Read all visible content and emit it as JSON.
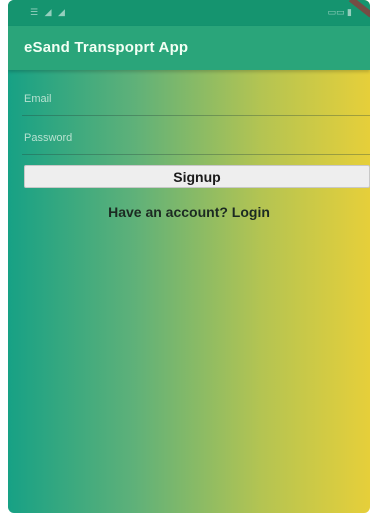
{
  "status_bar": {
    "left_icons": "☰ ◢ ◢",
    "right_icons": "▭▭ ▮"
  },
  "app_bar": {
    "title": "eSand Transpoprt App"
  },
  "form": {
    "email_placeholder": "Email",
    "password_placeholder": "Password",
    "signup_label": "Signup",
    "login_link": "Have an account? Login"
  },
  "colors": {
    "gradient_start": "#17a185",
    "gradient_end": "#e6cf3a",
    "app_bar": "#2aa57a"
  }
}
